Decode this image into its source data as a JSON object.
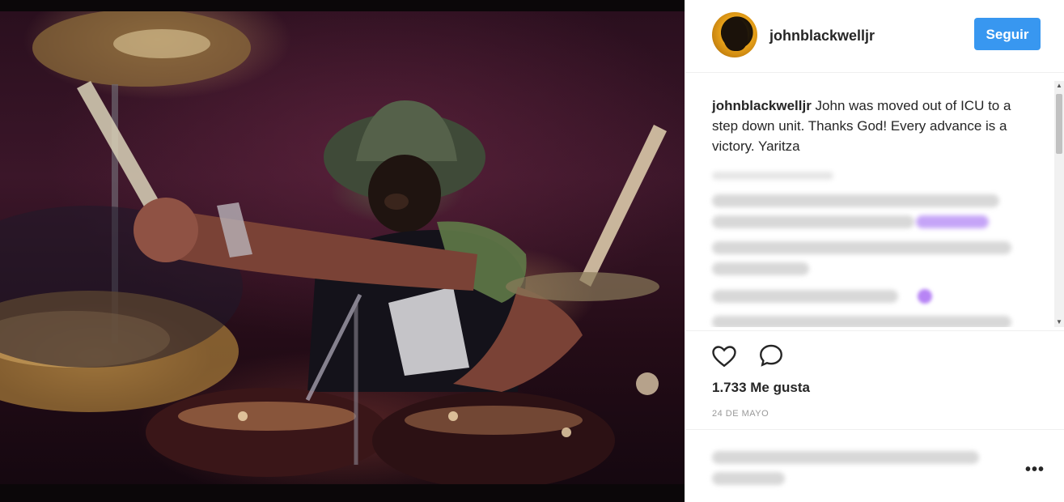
{
  "post": {
    "username": "johnblackwelljr",
    "follow_label": "Seguir",
    "caption_user": "johnblackwelljr",
    "caption_text": " John was moved out of ICU to a step down unit. Thanks God! Every advance is a victory. Yaritza",
    "likes": "1.733 Me gusta",
    "date": "24 DE MAYO"
  },
  "icons": {
    "like": "heart-icon",
    "comment": "speech-bubble-icon",
    "more": "ellipsis-icon"
  },
  "colors": {
    "follow_button": "#3897f0",
    "text": "#262626",
    "muted": "#999999"
  }
}
